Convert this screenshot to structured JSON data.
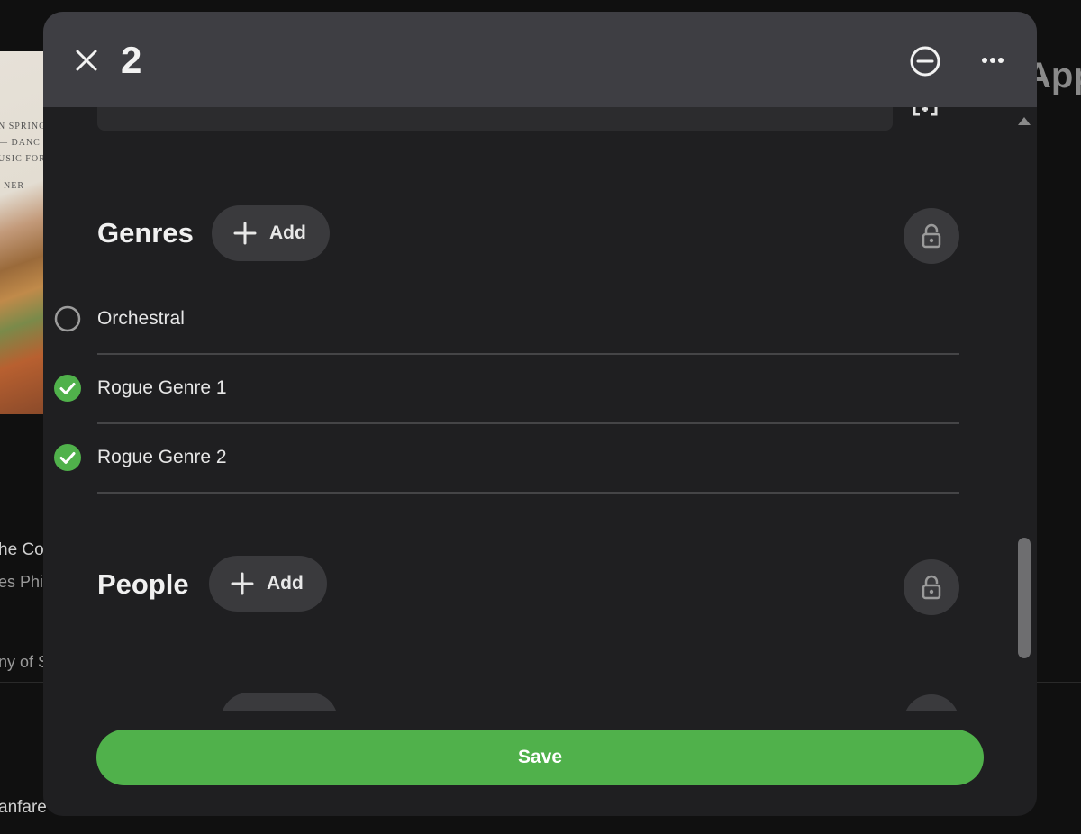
{
  "background": {
    "art_lines": [
      "N SPRING",
      "— DANC",
      "USIC FOR",
      "NER"
    ],
    "title_fragment": "App",
    "list_fragments": [
      "he Co",
      "es Phil",
      "ny of S",
      "anfare"
    ]
  },
  "modal": {
    "title": "2",
    "genres": {
      "heading": "Genres",
      "add_label": "Add",
      "items": [
        {
          "label": "Orchestral",
          "checked": false
        },
        {
          "label": "Rogue Genre 1",
          "checked": true
        },
        {
          "label": "Rogue Genre 2",
          "checked": true
        }
      ]
    },
    "people": {
      "heading": "People",
      "add_label": "Add"
    },
    "save_label": "Save"
  },
  "colors": {
    "accent": "#50b14b",
    "header_bg": "#3e3e43",
    "modal_bg": "#1f1f21"
  },
  "icons": [
    "close-icon",
    "minus-circle-icon",
    "more-horizontal-icon",
    "plus-icon",
    "lock-icon",
    "check-circle-icon",
    "radio-empty-icon"
  ]
}
